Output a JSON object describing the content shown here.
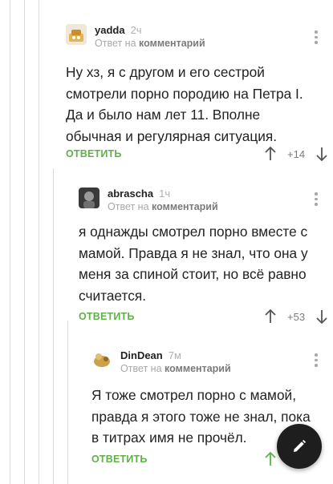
{
  "comments": [
    {
      "author": "yadda",
      "time": "2ч",
      "reply_prefix": "Ответ на",
      "reply_target": "комментарий",
      "text": "Ну хз, я с другом и его сестрой смотрели порно породию на Петра I. Да и было нам лет 11. Вполне обычная и регулярная ситуация.",
      "reply_label": "ОТВЕТИТЬ",
      "score": "+14"
    },
    {
      "author": "abrascha",
      "time": "1ч",
      "reply_prefix": "Ответ на",
      "reply_target": "комментарий",
      "text": "я однажды смотрел порно вместе с мамой. Правда я не знал, что она у меня за спиной стоит, но всё равно считается.",
      "reply_label": "ОТВЕТИТЬ",
      "score": "+53"
    },
    {
      "author": "DinDean",
      "time": "7м",
      "reply_prefix": "Ответ на",
      "reply_target": "комментарий",
      "text": "Я тоже смотрел порно с мамой, правда я этого тоже не знал, пока в титрах имя не прочёл.",
      "reply_label": "ОТВЕТИТЬ",
      "score": ""
    }
  ],
  "colors": {
    "accent": "#5fb04a",
    "fab": "#1e1e1e"
  },
  "icons": {
    "fab": "pencil-icon",
    "vote_up": "arrow-up-icon",
    "vote_down": "arrow-down-icon",
    "menu": "more-vertical-icon"
  }
}
